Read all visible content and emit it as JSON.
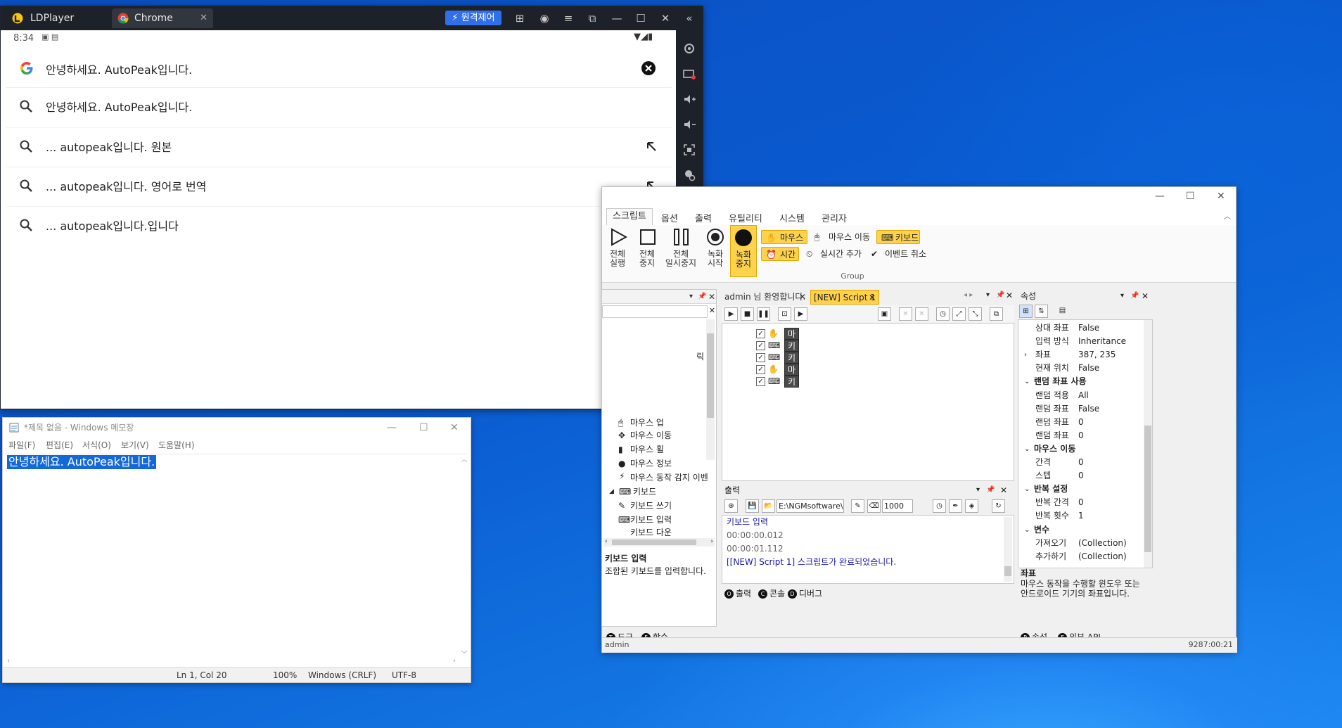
{
  "ldplayer": {
    "app_title": "LDPlayer",
    "tab_label": "Chrome",
    "remote_label": "원격제어",
    "time": "8:34",
    "search_value": "안녕하세요. AutoPeak입니다.",
    "suggestions": [
      "안녕하세요. AutoPeak입니다.",
      "... autopeak입니다. 원본",
      "... autopeak입니다. 영어로 번역",
      "... autopeak입니다.입니다"
    ]
  },
  "notepad": {
    "title": "*제목 없음 - Windows 메모장",
    "menu": [
      "파일(F)",
      "편집(E)",
      "서식(O)",
      "보기(V)",
      "도움말(H)"
    ],
    "text": "안녕하세요. AutoPeak입니다.",
    "status": {
      "pos": "Ln 1, Col 20",
      "zoom": "100%",
      "eol": "Windows (CRLF)",
      "enc": "UTF-8"
    }
  },
  "macro": {
    "ribbon_tabs": [
      "스크립트",
      "옵션",
      "출력",
      "유틸리티",
      "시스템",
      "관리자"
    ],
    "big_buttons": [
      {
        "l1": "전체",
        "l2": "실행"
      },
      {
        "l1": "전체",
        "l2": "중지"
      },
      {
        "l1": "전체",
        "l2": "일시중지"
      },
      {
        "l1": "녹화",
        "l2": "시작"
      },
      {
        "l1": "녹화",
        "l2": "중지"
      }
    ],
    "chips": {
      "mouse": "마우스",
      "mouse_move": "마우스 이동",
      "keyboard": "키보드",
      "time": "시간",
      "realtime": "실시간 추가",
      "cancel_event": "이벤트 취소"
    },
    "group_label": "Group",
    "doc_tabs": {
      "welcome": "admin 님 환영합니다.",
      "script": "[NEW] Script 1"
    },
    "tree": [
      "마우스 업",
      "마우스 이동",
      "마우스 휠",
      "마우스 정보",
      "마우스 동작 감지 이벤",
      "키보드",
      "키보드 쓰기",
      "키보드 입력",
      "키보드 다운"
    ],
    "tree_partial": "릭",
    "desc": {
      "title": "키보드 입력",
      "body": "조합된 키보드를 입력합니다."
    },
    "left_tabs": [
      "도구",
      "함수"
    ],
    "steps": [
      "마우스 클릭",
      "키보드 입력",
      "키보드 입력",
      "마우스 클릭",
      "키보드 입력"
    ],
    "output": {
      "title": "출력",
      "path": "E:\\NGMsoftware\\NG",
      "interval": "1000",
      "lines": [
        "키보드 입력",
        "00:00:00.012",
        "00:00:01.112",
        "[[NEW] Script 1] 스크립트가 완료되었습니다."
      ],
      "tabs": [
        "출력",
        "콘솔",
        "디버그"
      ]
    },
    "props": {
      "title": "속성",
      "rows": [
        {
          "t": "p",
          "k": "상대 좌표",
          "v": "False"
        },
        {
          "t": "p",
          "k": "입력 방식",
          "v": "Inheritance"
        },
        {
          "t": "p",
          "k": "좌표",
          "v": "387, 235"
        },
        {
          "t": "p",
          "k": "현재 위치",
          "v": "False"
        },
        {
          "t": "c",
          "k": "랜덤 좌표 사용"
        },
        {
          "t": "p",
          "k": "랜덤 적용",
          "v": "All"
        },
        {
          "t": "p",
          "k": "랜덤 좌표",
          "v": "False"
        },
        {
          "t": "p",
          "k": "랜덤 좌표",
          "v": "0"
        },
        {
          "t": "p",
          "k": "랜덤 좌표",
          "v": "0"
        },
        {
          "t": "c",
          "k": "마우스 이동"
        },
        {
          "t": "p",
          "k": "간격",
          "v": "0"
        },
        {
          "t": "p",
          "k": "스텝",
          "v": "0"
        },
        {
          "t": "c",
          "k": "반복 설정"
        },
        {
          "t": "p",
          "k": "반복 간격",
          "v": "0"
        },
        {
          "t": "p",
          "k": "반복 횟수",
          "v": "1"
        },
        {
          "t": "c",
          "k": "변수"
        },
        {
          "t": "p",
          "k": "가져오기",
          "v": "(Collection)"
        },
        {
          "t": "p",
          "k": "추가하기",
          "v": "(Collection)"
        }
      ],
      "desc_title": "좌표",
      "desc_body": "마우스 동작을 수행할 윈도우 또는 안드로이드 기기의 좌표입니다.",
      "tabs": [
        "속성",
        "외부 API"
      ]
    },
    "status_user": "admin",
    "status_right": "9287:00:21"
  }
}
